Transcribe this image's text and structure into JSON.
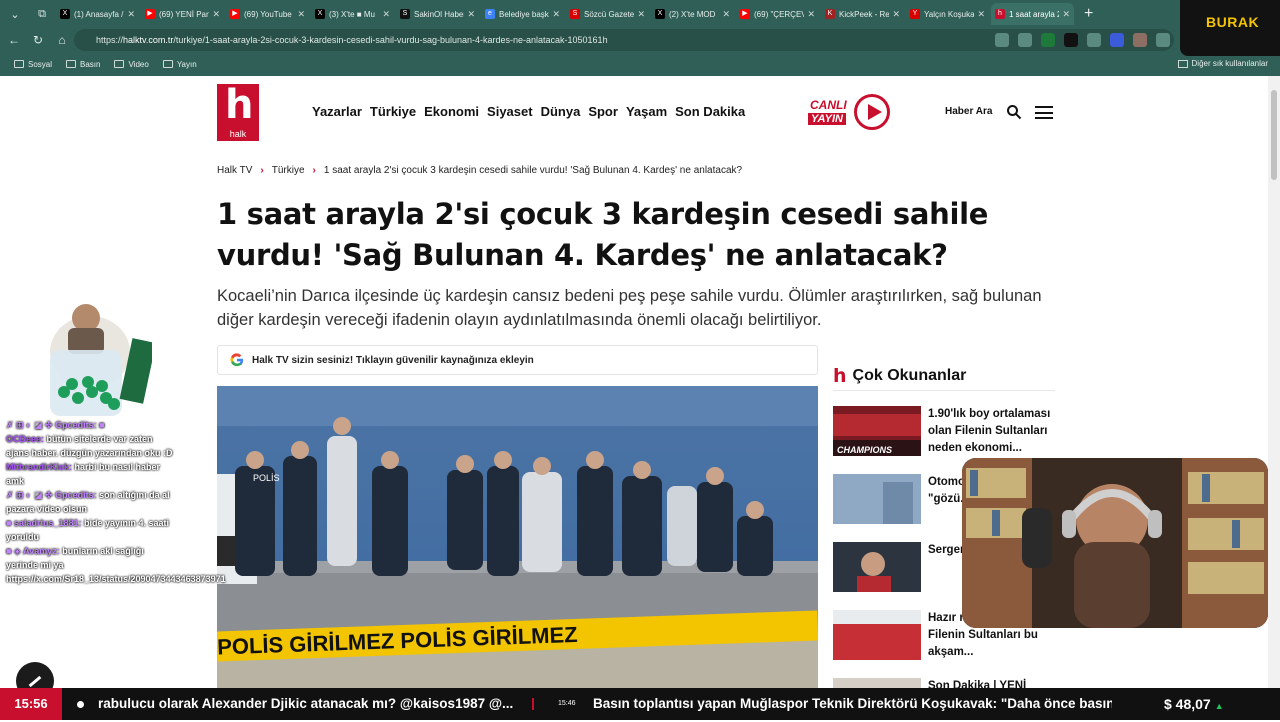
{
  "browser": {
    "tabs": [
      {
        "title": "(1) Anasayfa / X",
        "color": "#000000",
        "glyph": "X"
      },
      {
        "title": "(69) YENİ Parti",
        "color": "#ff0000",
        "glyph": "▶"
      },
      {
        "title": "(69) YouTube",
        "color": "#ff0000",
        "glyph": "▶"
      },
      {
        "title": "(3) X'te ■ Mu",
        "color": "#000000",
        "glyph": "X"
      },
      {
        "title": "SakinOl Haber",
        "color": "#111111",
        "glyph": "S"
      },
      {
        "title": "Belediye başka",
        "color": "#3b82f6",
        "glyph": "e"
      },
      {
        "title": "Sözcü Gazetes",
        "color": "#d90000",
        "glyph": "S"
      },
      {
        "title": "(2) X'te MOD",
        "color": "#000000",
        "glyph": "X"
      },
      {
        "title": "(69) \"ÇERÇEVE",
        "color": "#ff0000",
        "glyph": "▶"
      },
      {
        "title": "KickPeek - Rea",
        "color": "#a12222",
        "glyph": "K"
      },
      {
        "title": "Yalçın Koşukav",
        "color": "#d90000",
        "glyph": "Y"
      },
      {
        "title": "1 saat arayla 2",
        "color": "#c8102e",
        "glyph": "h"
      }
    ],
    "url_prefix": "https://",
    "url_domain": "halktv.com.tr",
    "url_path": "/turkiye/1-saat-arayla-2si-cocuk-3-kardesin-cesedi-sahil-vurdu-sag-bulunan-4-kardes-ne-anlatacak-1050161h",
    "bookmarks": [
      "Sosyal",
      "Basın",
      "Video",
      "Yayın"
    ],
    "bookmarks_other": "Diğer sık kullanılanlar",
    "overlay_name": "BURAK"
  },
  "site": {
    "logo_text": "halk",
    "nav": [
      "Yazarlar",
      "Türkiye",
      "Ekonomi",
      "Siyaset",
      "Dünya",
      "Spor",
      "Yaşam",
      "Son Dakika"
    ],
    "live_top": "CANLI",
    "live_bottom": "YAYIN",
    "search_label": "Haber Ara"
  },
  "article": {
    "breadcrumb": [
      "Halk TV",
      "Türkiye",
      "1 saat arayla 2'si çocuk 3 kardeşin cesedi sahile vurdu! 'Sağ Bulunan 4. Kardeş' ne anlatacak?"
    ],
    "title": "1 saat arayla 2'si çocuk 3 kardeşin cesedi sahile vurdu! 'Sağ Bulunan 4. Kardeş' ne anlatacak?",
    "spot": "Kocaeli’nin Darıca ilçesinde üç kardeşin cansız bedeni peş peşe sahile vurdu. Ölümler araştırılırken, sağ bulunan diğer kardeşin vereceği ifadenin olayın aydınlatılmasında önemli olacağı belirtiliyor.",
    "google_banner": "Halk TV sizin sesiniz! Tıklayın güvenilir kaynağınıza ekleyin",
    "photo_tape_text": "POLİS  GİRİLMEZ  POLİS  GİRİLMEZ",
    "police_vest_text": "POLİS"
  },
  "sidebar": {
    "title": "Çok Okunanlar",
    "items": [
      {
        "text": "1.90'lık boy ortalaması olan Filenin Sultanları neden ekonomi...",
        "thumb_caption": "CHAMPIONS"
      },
      {
        "text": "Otomobil mühendisi \"gözü..."
      },
      {
        "text": "Sergen yıldızı Beşikt..."
      },
      {
        "text": "Hazır mısın Gurumuz Filenin Sultanları bu akşam..."
      },
      {
        "text": "Son Dakika | YENİ"
      }
    ]
  },
  "chat": [
    {
      "user": "",
      "msg": "✗ ⊞ ◐ ◪ ✤ Gpcedits: ■"
    },
    {
      "user": "OCDeee:",
      "msg": "bütün sitelerde var zaten ajans haber. düzgün yazarından oku :D"
    },
    {
      "user": "MithrandirKick:",
      "msg": "harbi bu nasıl haber amk"
    },
    {
      "user": "✗ ⊞ ◐ ◪ ✤ Gpcedits:",
      "msg": "son altığını da al pazara video olsun"
    },
    {
      "user": "■ saladrius_1881:",
      "msg": "bide yayının 4. saati yoruldu"
    },
    {
      "user": "■ ◈ Avamyz:",
      "msg": "bunların akl sağlığı yerinde mi ya https://x.com/Sr18_13/status/2090473443463873971"
    }
  ],
  "ticker": {
    "time": "15:56",
    "item1": "rabulucu olarak Alexander Djikic atanacak mı? @kaisos1987 @...",
    "item2_time": "15:46",
    "item2": "Basın toplantısı yapan Muğlaspor Teknik Direktörü Koşukavak: \"Daha önce basın",
    "fx_value": "$ 48,07",
    "fx_arrow": "▲"
  }
}
